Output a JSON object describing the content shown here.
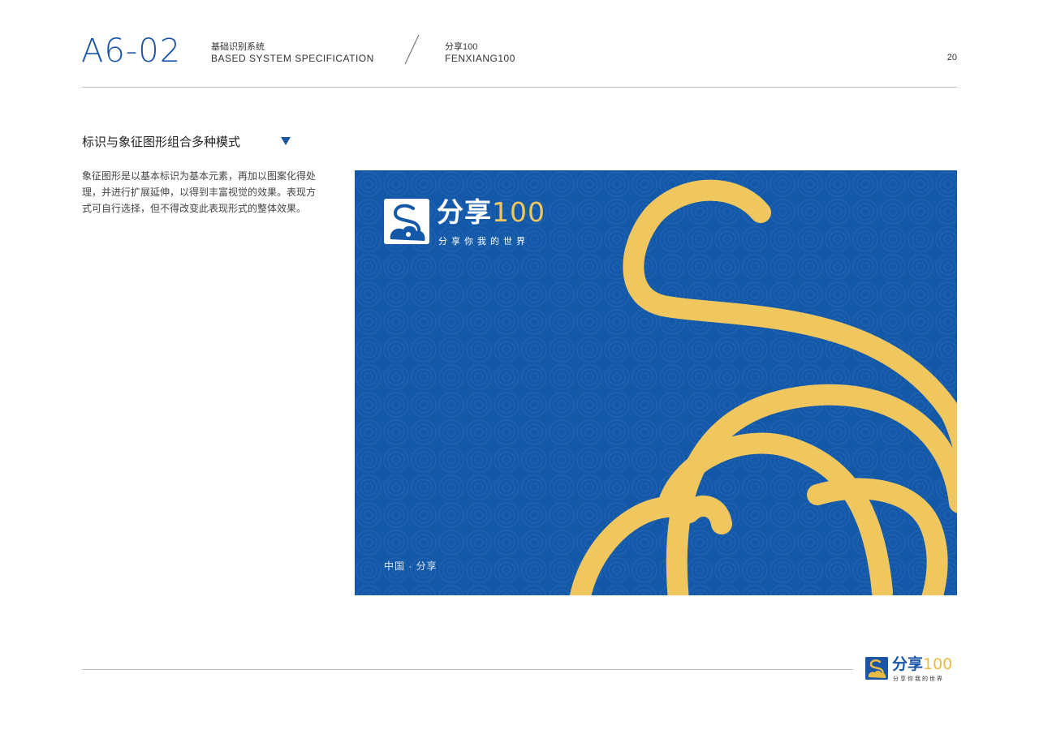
{
  "header": {
    "code": "A6-02",
    "system_cn": "基础识别系统",
    "system_en": "BASED SYSTEM SPECIFICATION",
    "brand_cn": "分享100",
    "brand_en": "FENXIANG100",
    "page_number": "20"
  },
  "section": {
    "title": "标识与象征图形组合多种模式",
    "description": "象征图形是以基本标识为基本元素，再加以图案化得处理，并进行扩展延伸，以得到丰富视觉的效果。表现方式可自行选择，但不得改变此表现形式的整体效果。"
  },
  "card": {
    "brand_text": "分享",
    "brand_number": "100",
    "slogan": "分享你我的世界",
    "footer": "中国 · 分享",
    "colors": {
      "background": "#1458a8",
      "accent": "#f0c75e",
      "text": "#ffffff"
    }
  },
  "footer_logo": {
    "brand_text": "分享",
    "brand_number": "100",
    "slogan": "分享你我的世界",
    "colors": {
      "primary": "#1a55a8",
      "accent": "#e9bb45"
    }
  },
  "icons": {
    "dropdown": "triangle-down-icon",
    "logo": "monkey-cloud-logo-icon"
  }
}
